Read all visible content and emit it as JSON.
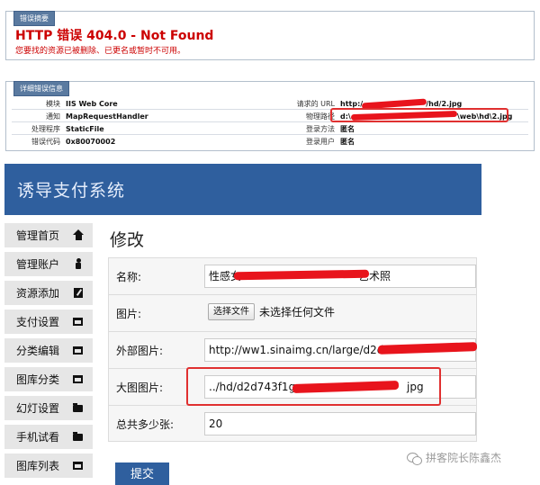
{
  "iis": {
    "summary_tab": "错误摘要",
    "error_title": "HTTP 错误 404.0 - Not Found",
    "error_desc": "您要找的资源已被删除、已更名或暂时不可用。",
    "detail_tab": "详细错误信息",
    "details_left": [
      {
        "key": "模块",
        "value": "IIS Web Core"
      },
      {
        "key": "通知",
        "value": "MapRequestHandler"
      },
      {
        "key": "处理程序",
        "value": "StaticFile"
      },
      {
        "key": "错误代码",
        "value": "0x80070002"
      }
    ],
    "details_right": [
      {
        "key": "请求的 URL",
        "value_start": "http:/",
        "value_end": "/hd/2.jpg"
      },
      {
        "key": "物理路径",
        "value_start": "d:\\",
        "value_end": "\\web\\hd\\2.jpg"
      },
      {
        "key": "登录方法",
        "value_start": "匿名",
        "value_end": ""
      },
      {
        "key": "登录用户",
        "value_start": "匿名",
        "value_end": ""
      }
    ],
    "colors": {
      "error_red": "#cc0000",
      "tab_blue": "#5a7aa0"
    }
  },
  "app": {
    "title": "诱导支付系统",
    "sidebar": [
      {
        "label": "管理首页",
        "icon": "home-icon"
      },
      {
        "label": "管理账户",
        "icon": "user-icon"
      },
      {
        "label": "资源添加",
        "icon": "edit-icon"
      },
      {
        "label": "支付设置",
        "icon": "window-icon"
      },
      {
        "label": "分类编辑",
        "icon": "window-icon"
      },
      {
        "label": "图库分类",
        "icon": "window-icon"
      },
      {
        "label": "幻灯设置",
        "icon": "folder-icon"
      },
      {
        "label": "手机试看",
        "icon": "folder-icon"
      },
      {
        "label": "图库列表",
        "icon": "window-icon"
      }
    ],
    "page_title": "修改",
    "form": {
      "name_label": "名称:",
      "name_value_start": "性感女",
      "name_value_end": "艺术照",
      "image_label": "图片:",
      "file_button": "选择文件",
      "file_none": "未选择任何文件",
      "external_label": "外部图片:",
      "external_value": "http://ww1.sinaimg.cn/large/d2d743",
      "large_label": "大图图片:",
      "large_value_start": "../hd/d2d743f1gw",
      "large_value_end": "jpg",
      "count_label": "总共多少张:",
      "count_value": "20"
    },
    "submit_label": "提交",
    "colors": {
      "header_blue": "#2f5f9e",
      "highlight_red": "#e03030"
    }
  },
  "watermark": "拼客院长陈鑫杰"
}
